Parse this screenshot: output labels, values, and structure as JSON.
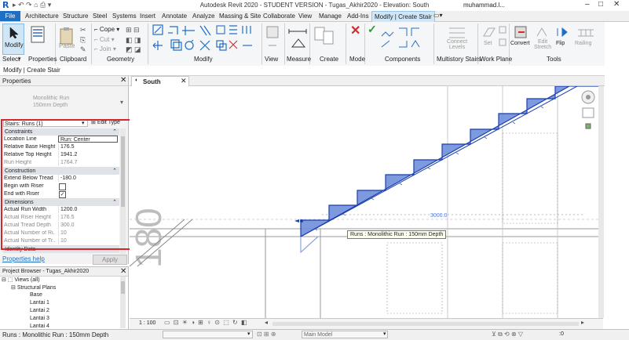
{
  "window": {
    "app_title": "Autodesk Revit 2020 - STUDENT VERSION - Tugas_Akhir2020 - Elevation: South",
    "user": "muhammad.l...",
    "logo": "R"
  },
  "menu": {
    "file": "File",
    "tabs": [
      "Architecture",
      "Structure",
      "Steel",
      "Systems",
      "Insert",
      "Annotate",
      "Analyze",
      "Massing & Site",
      "Collaborate",
      "View",
      "Manage",
      "Add-Ins"
    ],
    "active_tab": "Modify | Create Stair"
  },
  "ribbon": {
    "modify_label": "Modify",
    "cope_label": "Cope",
    "cut_label": "Cut",
    "join_label": "Join",
    "paste_label": "Paste",
    "panels": {
      "select": "Select",
      "properties": "Properties",
      "clipboard": "Clipboard",
      "geometry": "Geometry",
      "modify": "Modify",
      "view": "View",
      "measure": "Measure",
      "create": "Create",
      "mode": "Mode",
      "components": "Components",
      "multistory": "Multistory Stairs",
      "work_plane": "Work Plane",
      "tools": "Tools"
    },
    "connect_levels": "Connect Levels",
    "set": "Set",
    "convert": "Convert",
    "edit_stretch": "Edit Stretch",
    "flip": "Flip",
    "railing": "Railing"
  },
  "context_bar": "Modify | Create Stair",
  "properties": {
    "title": "Properties",
    "type_name": "Monolithic Run",
    "type_sub": "150mm Depth",
    "selector": "Stairs: Runs (1)",
    "edit_type": "Edit Type",
    "groups": [
      {
        "name": "Constraints",
        "rows": [
          {
            "k": "Location Line",
            "v": "Run: Center",
            "grey": false
          },
          {
            "k": "Relative Base Height",
            "v": "176.5",
            "grey": false
          },
          {
            "k": "Relative Top Height",
            "v": "1941.2",
            "grey": false
          },
          {
            "k": "Run Height",
            "v": "1764.7",
            "grey": true
          }
        ]
      },
      {
        "name": "Construction",
        "rows": [
          {
            "k": "Extend Below Tread ...",
            "v": "-180.0",
            "grey": false
          },
          {
            "k": "Begin with Riser",
            "v": "",
            "grey": false,
            "check": false
          },
          {
            "k": "End with Riser",
            "v": "",
            "grey": false,
            "check": true
          }
        ]
      },
      {
        "name": "Dimensions",
        "rows": [
          {
            "k": "Actual Run Width",
            "v": "1200.0",
            "grey": false
          },
          {
            "k": "Actual Riser Height",
            "v": "176.5",
            "grey": true
          },
          {
            "k": "Actual Tread Depth",
            "v": "300.0",
            "grey": true
          },
          {
            "k": "Actual Number of Ri...",
            "v": "10",
            "grey": true
          },
          {
            "k": "Actual Number of Tr...",
            "v": "10",
            "grey": true
          }
        ]
      }
    ],
    "identity": "Identity Data",
    "help_link": "Properties help",
    "apply": "Apply"
  },
  "browser": {
    "title": "Project Browser - Tugas_Akhir2020",
    "items": [
      {
        "label": "Views (all)",
        "indent": 0
      },
      {
        "label": "Structural Plans",
        "indent": 1
      },
      {
        "label": "Base",
        "indent": 2
      },
      {
        "label": "Lantai 1",
        "indent": 2
      },
      {
        "label": "Lantai 2",
        "indent": 2
      },
      {
        "label": "Lantai 3",
        "indent": 2
      },
      {
        "label": "Lantai 4",
        "indent": 2
      }
    ]
  },
  "view": {
    "tab": "South",
    "dim_text": "3000.0",
    "tooltip": "Runs : Monolithic Run : 150mm Depth",
    "big_dim": "180",
    "scale": "1 : 100"
  },
  "status": {
    "text": "Runs : Monolithic Run : 150mm Depth",
    "model": "Main Model",
    "zero": ":0"
  },
  "colors": {
    "accent": "#1f6fc5",
    "stair_fill": "#6f8fdb",
    "stair_stroke": "#1b3fae",
    "highlight": "#d5262e"
  }
}
